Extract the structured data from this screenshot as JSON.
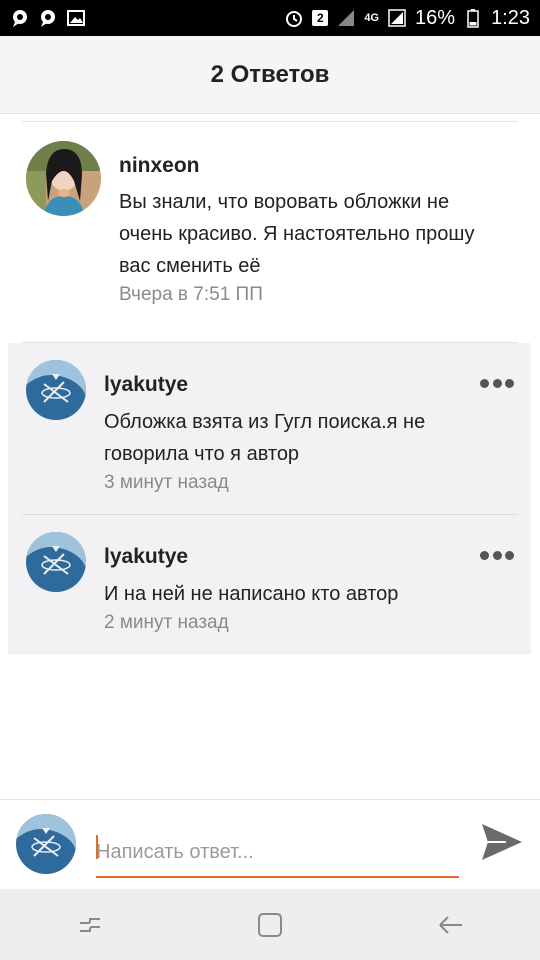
{
  "status_bar": {
    "left_icons": [
      "chat-bubble-icon",
      "chat-bubble-icon",
      "image-icon"
    ],
    "badge": "2",
    "network": "4G",
    "battery_percent": "16%",
    "time": "1:23"
  },
  "header": {
    "title": "2 Ответов"
  },
  "comments": [
    {
      "username": "ninxeon",
      "text_lines": [
        "Вы знали, что воровать обложки не",
        "очень красиво. Я настоятельно прошу",
        "вас сменить её"
      ],
      "timestamp": "Вчера в 7:51 ПП"
    },
    {
      "username": "lyakutye",
      "text_lines": [
        "Обложка взята из Гугл поиска.я не",
        "говорила что я автор"
      ],
      "timestamp": "3 минут назад"
    },
    {
      "username": "lyakutye",
      "text_lines": [
        "И на ней не написано кто автор"
      ],
      "timestamp": "2 минут назад"
    }
  ],
  "compose": {
    "placeholder": "Написать ответ...",
    "send_icon": "send-icon"
  },
  "nav": {
    "icons": [
      "recent-apps-icon",
      "home-icon",
      "back-icon"
    ]
  },
  "colors": {
    "accent": "#e8692b",
    "reply_background": "#f2f2f4",
    "header_background": "#f5f5f5",
    "timestamp": "#8a8a8a"
  }
}
